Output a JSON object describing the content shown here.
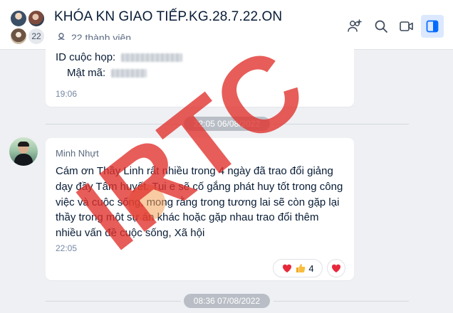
{
  "header": {
    "title": "KHÓA KN GIAO TIẾP.KG.28.7.22.ON",
    "member_count_badge": "22",
    "member_text": "22 thành viên",
    "icons": [
      "add-member-icon",
      "search-icon",
      "video-call-icon",
      "toggle-panel-icon"
    ]
  },
  "messages": [
    {
      "id_label": "ID cuộc họp:",
      "password_label": "Mật mã:",
      "time": "19:06"
    },
    {
      "sender": "Minh Nhựt",
      "text": "Cám ơn Thầy Linh rất nhiều trong 4 ngày đã trao đổi giảng dạy đầy Tâm huyết. Tui e sẽ cố gắng phát huy tốt trong công việc và cuộc sống, mong rằng trong tương lai sẽ còn gặp lại thầy trong một sự án khác hoặc gặp nhau trao đổi thêm nhiều vấn đề cuộc sống, Xã hội",
      "time": "22:05",
      "reaction_count": "4",
      "reactions": [
        "heart-emoji",
        "thumbs-up-emoji"
      ]
    }
  ],
  "date_separators": [
    "22:05 06/08/2022",
    "08:36 07/08/2022"
  ],
  "watermark_text": "IRTC",
  "colors": {
    "accent": "#0068ff",
    "active_button_bg": "#dbe8ff",
    "watermark": "#e0302a"
  }
}
